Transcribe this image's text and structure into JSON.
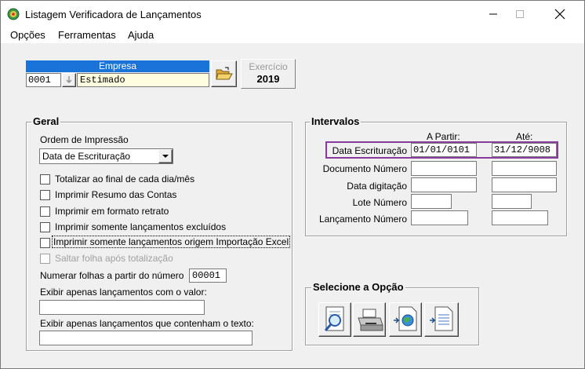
{
  "window": {
    "title": "Listagem Verificadora de Lançamentos"
  },
  "menu": {
    "items": [
      "Opções",
      "Ferramentas",
      "Ajuda"
    ]
  },
  "empresa": {
    "header": "Empresa",
    "code": "0001",
    "name": "Estimado"
  },
  "exercicio": {
    "label": "Exercício",
    "year": "2019"
  },
  "geral": {
    "title": "Geral",
    "ordem_label": "Ordem de Impressão",
    "ordem_value": "Data de Escrituração",
    "options": [
      "Totalizar ao final de cada dia/mês",
      "Imprimir Resumo das Contas",
      "Imprimir em formato retrato",
      "Imprimir somente lançamentos excluídos",
      "Imprimir somente lançamentos origem Importação Excel",
      "Saltar folha após totalização"
    ],
    "numerar_label": "Numerar folhas a partir do número",
    "numerar_value": "00001",
    "valor_label": "Exibir apenas lançamentos com o valor:",
    "texto_label": "Exibir apenas lançamentos que contenham o texto:"
  },
  "intervalos": {
    "title": "Intervalos",
    "col_from": "A Partir:",
    "col_to": "Até:",
    "rows": [
      {
        "label": "Data Escrituração",
        "from": "01/01/0101",
        "to": "31/12/9008"
      },
      {
        "label": "Documento Número",
        "from": "",
        "to": ""
      },
      {
        "label": "Data digitação",
        "from": "",
        "to": ""
      },
      {
        "label": "Lote Número",
        "from": "",
        "to": ""
      },
      {
        "label": "Lançamento Número",
        "from": "",
        "to": ""
      }
    ],
    "highlight_color": "#8b3a9e"
  },
  "selecione": {
    "title": "Selecione a Opção"
  }
}
